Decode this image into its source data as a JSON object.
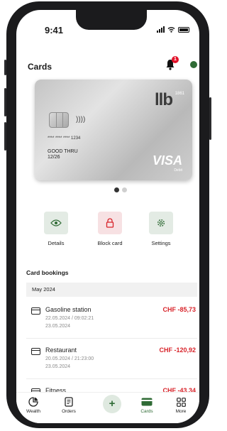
{
  "status_bar": {
    "time": "9:41"
  },
  "header": {
    "title": "Cards",
    "notification_count": "1"
  },
  "card": {
    "brand_logo": "llb",
    "brand_year": "1861",
    "masked_number": "**** **** **** 1234",
    "good_thru_label": "GOOD THRU",
    "expiry": "12/26",
    "network": "VISA",
    "card_type": "Debit",
    "contactless_symbol": "))))"
  },
  "actions": [
    {
      "label": "Details",
      "icon": "eye-icon"
    },
    {
      "label": "Block card",
      "icon": "lock-icon"
    },
    {
      "label": "Settings",
      "icon": "gear-icon"
    }
  ],
  "bookings": {
    "section_title": "Card bookings",
    "month": "May 2024",
    "items": [
      {
        "name": "Gasoline station",
        "date": "22.05.2024 / 09:02:21",
        "value_date": "23.05.2024",
        "amount": "CHF -85,73"
      },
      {
        "name": "Restaurant",
        "date": "20.05.2024 / 21:23:00",
        "value_date": "23.05.2024",
        "amount": "CHF -120,92"
      },
      {
        "name": "Fitness",
        "date": "",
        "value_date": "",
        "amount": "CHF -43,34"
      }
    ]
  },
  "tabbar": {
    "items": [
      {
        "label": "Wealth",
        "icon": "wealth-icon"
      },
      {
        "label": "Orders",
        "icon": "orders-icon"
      },
      {
        "label": "Cards",
        "icon": "cards-icon",
        "active": true
      },
      {
        "label": "More",
        "icon": "more-icon"
      }
    ],
    "add_symbol": "+"
  },
  "colors": {
    "accent": "#2f6b35",
    "negative": "#d8232a",
    "badge": "#e3122a"
  }
}
